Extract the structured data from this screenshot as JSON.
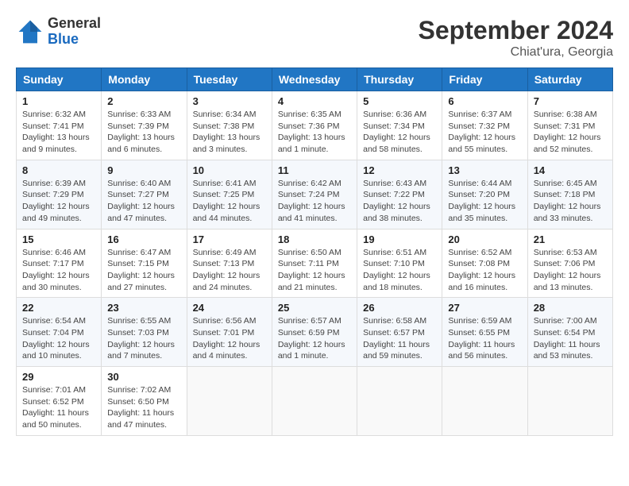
{
  "logo": {
    "general": "General",
    "blue": "Blue"
  },
  "title": "September 2024",
  "location": "Chiat'ura, Georgia",
  "days_header": [
    "Sunday",
    "Monday",
    "Tuesday",
    "Wednesday",
    "Thursday",
    "Friday",
    "Saturday"
  ],
  "weeks": [
    [
      {
        "day": "1",
        "info": "Sunrise: 6:32 AM\nSunset: 7:41 PM\nDaylight: 13 hours\nand 9 minutes."
      },
      {
        "day": "2",
        "info": "Sunrise: 6:33 AM\nSunset: 7:39 PM\nDaylight: 13 hours\nand 6 minutes."
      },
      {
        "day": "3",
        "info": "Sunrise: 6:34 AM\nSunset: 7:38 PM\nDaylight: 13 hours\nand 3 minutes."
      },
      {
        "day": "4",
        "info": "Sunrise: 6:35 AM\nSunset: 7:36 PM\nDaylight: 13 hours\nand 1 minute."
      },
      {
        "day": "5",
        "info": "Sunrise: 6:36 AM\nSunset: 7:34 PM\nDaylight: 12 hours\nand 58 minutes."
      },
      {
        "day": "6",
        "info": "Sunrise: 6:37 AM\nSunset: 7:32 PM\nDaylight: 12 hours\nand 55 minutes."
      },
      {
        "day": "7",
        "info": "Sunrise: 6:38 AM\nSunset: 7:31 PM\nDaylight: 12 hours\nand 52 minutes."
      }
    ],
    [
      {
        "day": "8",
        "info": "Sunrise: 6:39 AM\nSunset: 7:29 PM\nDaylight: 12 hours\nand 49 minutes."
      },
      {
        "day": "9",
        "info": "Sunrise: 6:40 AM\nSunset: 7:27 PM\nDaylight: 12 hours\nand 47 minutes."
      },
      {
        "day": "10",
        "info": "Sunrise: 6:41 AM\nSunset: 7:25 PM\nDaylight: 12 hours\nand 44 minutes."
      },
      {
        "day": "11",
        "info": "Sunrise: 6:42 AM\nSunset: 7:24 PM\nDaylight: 12 hours\nand 41 minutes."
      },
      {
        "day": "12",
        "info": "Sunrise: 6:43 AM\nSunset: 7:22 PM\nDaylight: 12 hours\nand 38 minutes."
      },
      {
        "day": "13",
        "info": "Sunrise: 6:44 AM\nSunset: 7:20 PM\nDaylight: 12 hours\nand 35 minutes."
      },
      {
        "day": "14",
        "info": "Sunrise: 6:45 AM\nSunset: 7:18 PM\nDaylight: 12 hours\nand 33 minutes."
      }
    ],
    [
      {
        "day": "15",
        "info": "Sunrise: 6:46 AM\nSunset: 7:17 PM\nDaylight: 12 hours\nand 30 minutes."
      },
      {
        "day": "16",
        "info": "Sunrise: 6:47 AM\nSunset: 7:15 PM\nDaylight: 12 hours\nand 27 minutes."
      },
      {
        "day": "17",
        "info": "Sunrise: 6:49 AM\nSunset: 7:13 PM\nDaylight: 12 hours\nand 24 minutes."
      },
      {
        "day": "18",
        "info": "Sunrise: 6:50 AM\nSunset: 7:11 PM\nDaylight: 12 hours\nand 21 minutes."
      },
      {
        "day": "19",
        "info": "Sunrise: 6:51 AM\nSunset: 7:10 PM\nDaylight: 12 hours\nand 18 minutes."
      },
      {
        "day": "20",
        "info": "Sunrise: 6:52 AM\nSunset: 7:08 PM\nDaylight: 12 hours\nand 16 minutes."
      },
      {
        "day": "21",
        "info": "Sunrise: 6:53 AM\nSunset: 7:06 PM\nDaylight: 12 hours\nand 13 minutes."
      }
    ],
    [
      {
        "day": "22",
        "info": "Sunrise: 6:54 AM\nSunset: 7:04 PM\nDaylight: 12 hours\nand 10 minutes."
      },
      {
        "day": "23",
        "info": "Sunrise: 6:55 AM\nSunset: 7:03 PM\nDaylight: 12 hours\nand 7 minutes."
      },
      {
        "day": "24",
        "info": "Sunrise: 6:56 AM\nSunset: 7:01 PM\nDaylight: 12 hours\nand 4 minutes."
      },
      {
        "day": "25",
        "info": "Sunrise: 6:57 AM\nSunset: 6:59 PM\nDaylight: 12 hours\nand 1 minute."
      },
      {
        "day": "26",
        "info": "Sunrise: 6:58 AM\nSunset: 6:57 PM\nDaylight: 11 hours\nand 59 minutes."
      },
      {
        "day": "27",
        "info": "Sunrise: 6:59 AM\nSunset: 6:55 PM\nDaylight: 11 hours\nand 56 minutes."
      },
      {
        "day": "28",
        "info": "Sunrise: 7:00 AM\nSunset: 6:54 PM\nDaylight: 11 hours\nand 53 minutes."
      }
    ],
    [
      {
        "day": "29",
        "info": "Sunrise: 7:01 AM\nSunset: 6:52 PM\nDaylight: 11 hours\nand 50 minutes."
      },
      {
        "day": "30",
        "info": "Sunrise: 7:02 AM\nSunset: 6:50 PM\nDaylight: 11 hours\nand 47 minutes."
      },
      {
        "day": "",
        "info": ""
      },
      {
        "day": "",
        "info": ""
      },
      {
        "day": "",
        "info": ""
      },
      {
        "day": "",
        "info": ""
      },
      {
        "day": "",
        "info": ""
      }
    ]
  ]
}
